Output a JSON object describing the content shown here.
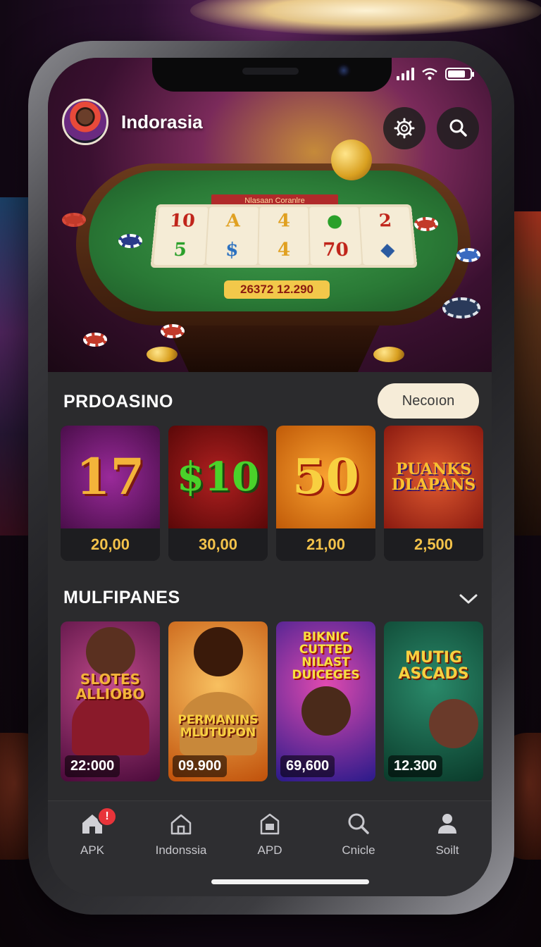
{
  "header": {
    "username": "Indorasia"
  },
  "hero": {
    "banner_text": "Nlasaan Coranlre",
    "reel_symbols": [
      [
        "10",
        "5"
      ],
      [
        "A",
        "$"
      ],
      [
        "4",
        "4"
      ],
      [
        "●",
        "70"
      ],
      [
        "2",
        "◆"
      ]
    ],
    "reel_total": "26372 12.290"
  },
  "section1": {
    "title": "PRDOASINO",
    "action_label": "Necoıon",
    "tiles": [
      {
        "art": "17",
        "price": "20,00",
        "bg": "#6a1a6a",
        "color": "#f3b43a"
      },
      {
        "art": "$10",
        "price": "30,00",
        "bg": "#8a1414",
        "color": "#4ad22a"
      },
      {
        "art": "50",
        "price": "21,00",
        "bg": "#e07a10",
        "color": "#f8d040"
      },
      {
        "art": "PUANKS DLAPANS",
        "price": "2,500",
        "bg": "#c23a20",
        "color": "#f8c030"
      }
    ]
  },
  "section2": {
    "title": "MULFIPANES",
    "tiles": [
      {
        "title": "SLOTES ALLIOBO",
        "price": "22:000",
        "bg": "#7a1a5a",
        "accent": "#f3b43a"
      },
      {
        "title": "PERMANINS MLUTUPON",
        "price": "09.900",
        "bg": "#e08a1a",
        "accent": "#f8d040"
      },
      {
        "title": "BIKNIC CUTTED NILAST DUICEGES",
        "price": "69,600",
        "bg": "#3a2aa0",
        "accent": "#f8e040"
      },
      {
        "title": "MUTIG ASCADS",
        "price": "12.300",
        "bg": "#1a5a4a",
        "accent": "#f8d040"
      }
    ]
  },
  "tabbar": {
    "tabs": [
      {
        "label": "APK",
        "icon": "home-icon",
        "badge": "!"
      },
      {
        "label": "Indonssia",
        "icon": "house-outline-icon"
      },
      {
        "label": "APD",
        "icon": "shop-icon"
      },
      {
        "label": "Cnicle",
        "icon": "search-icon"
      },
      {
        "label": "Soilt",
        "icon": "profile-icon"
      }
    ]
  }
}
